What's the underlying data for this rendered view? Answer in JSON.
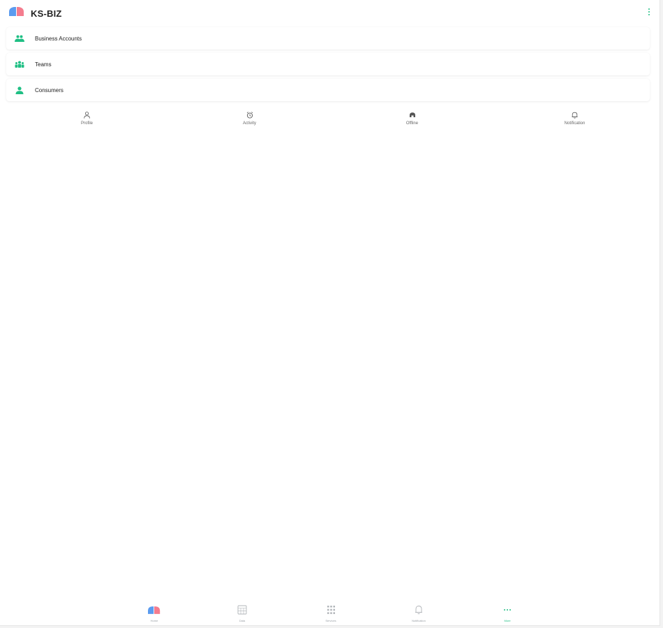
{
  "header": {
    "brand": "KS-BIZ"
  },
  "menu": {
    "items": [
      {
        "label": "Business Accounts",
        "icon": "people-group-icon"
      },
      {
        "label": "Teams",
        "icon": "teams-icon"
      },
      {
        "label": "Consumers",
        "icon": "person-icon"
      }
    ]
  },
  "quick": {
    "items": [
      {
        "label": "Profile",
        "icon": "person-outline-icon"
      },
      {
        "label": "Activity",
        "icon": "alarm-clock-icon"
      },
      {
        "label": "Offline",
        "icon": "offline-icon"
      },
      {
        "label": "Notification",
        "icon": "bell-icon"
      }
    ]
  },
  "bottom_nav": {
    "items": [
      {
        "label": "Home",
        "icon": "logo-icon",
        "active": false
      },
      {
        "label": "Data",
        "icon": "calendar-icon",
        "active": false
      },
      {
        "label": "Services",
        "icon": "grid-icon",
        "active": false
      },
      {
        "label": "Notification",
        "icon": "bell-icon",
        "active": false
      },
      {
        "label": "More",
        "icon": "more-dots-icon",
        "active": true
      }
    ]
  },
  "colors": {
    "accent": "#1fbf84",
    "logo_blue": "#5b9bef",
    "logo_pink": "#f47c8e",
    "muted": "#9aa0a6"
  }
}
